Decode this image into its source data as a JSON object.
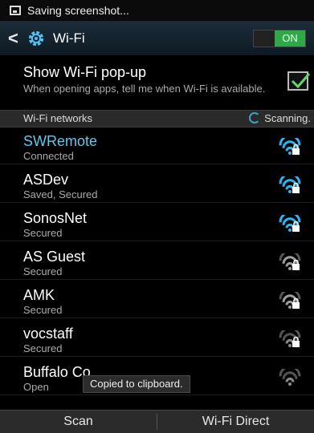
{
  "status_bar": {
    "text": "Saving screenshot..."
  },
  "action_bar": {
    "title": "Wi-Fi",
    "toggle_label": "ON",
    "accent": "#2fa84a"
  },
  "popup_setting": {
    "title": "Show Wi-Fi pop-up",
    "description": "When opening apps, tell me when Wi-Fi is available.",
    "checked": true
  },
  "section": {
    "label": "Wi-Fi networks",
    "scanning": "Scanning."
  },
  "networks": [
    {
      "name": "SWRemote",
      "status": "Connected",
      "signal": "full",
      "locked": true
    },
    {
      "name": "ASDev",
      "status": "Saved, Secured",
      "signal": "full",
      "locked": true
    },
    {
      "name": "SonosNet",
      "status": "Secured",
      "signal": "full",
      "locked": true
    },
    {
      "name": "AS Guest",
      "status": "Secured",
      "signal": "medium",
      "locked": true
    },
    {
      "name": "AMK",
      "status": "Secured",
      "signal": "medium",
      "locked": true
    },
    {
      "name": "vocstaff",
      "status": "Secured",
      "signal": "low",
      "locked": true
    },
    {
      "name": "Buffalo Co",
      "status": "Open",
      "signal": "low",
      "locked": false
    }
  ],
  "toast": {
    "text": "Copied to clipboard."
  },
  "bottom_bar": {
    "scan_label": "Scan",
    "direct_label": "Wi-Fi Direct"
  }
}
